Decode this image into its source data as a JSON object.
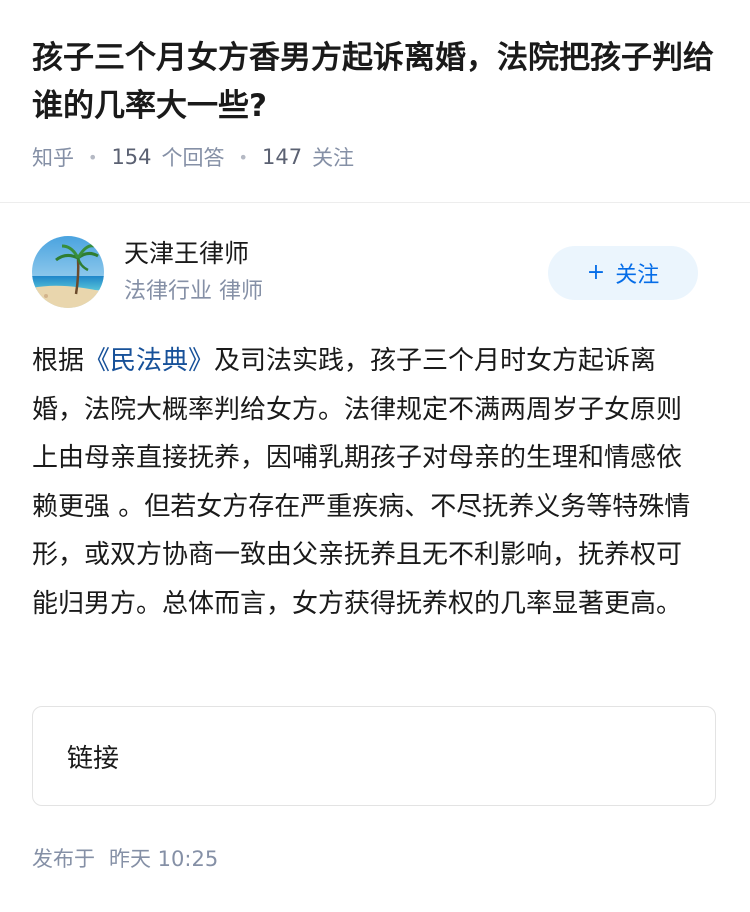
{
  "question": {
    "title": "孩子三个月女方香男方起诉离婚，法院把孩子判给谁的几率大一些?",
    "source": "知乎",
    "answer_count": "154",
    "answer_count_label": "个回答",
    "follower_count": "147",
    "follower_label": "关注"
  },
  "author": {
    "avatar_icon": "beach-palm-avatar",
    "name": "天津王律师",
    "description": "法律行业 律师",
    "follow_plus": "+",
    "follow_label": "关注"
  },
  "answer": {
    "text_before": "根据",
    "link_text": "《民法典》",
    "text_after": "及司法实践，孩子三个月时女方起诉离婚，法院大概率判给女方。法律规定不满两周岁子女原则上由母亲直接抚养，因哺乳期孩子对母亲的生理和情感依赖更强 。但若女方存在严重疾病、不尽抚养义务等特殊情形，或双方协商一致由父亲抚养且无不利影响，抚养权可能归男方。总体而言，女方获得抚养权的几率显著更高。"
  },
  "link_card": {
    "label": "链接"
  },
  "publish": {
    "prefix": "发布于",
    "time": "昨天 10:25"
  },
  "colors": {
    "accent": "#056de8",
    "follow_bg": "#ebf5fd",
    "meta_gray": "#8590a6",
    "link_blue": "#175199"
  }
}
